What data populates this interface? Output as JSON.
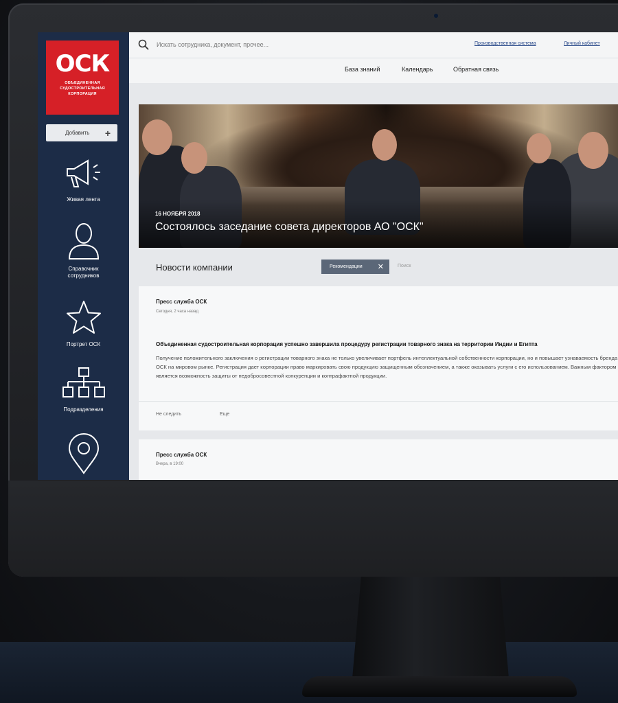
{
  "search": {
    "placeholder": "Искать сотрудника, документ, прочее..."
  },
  "header": {
    "links": [
      "Производственная система",
      "Личный кабинет"
    ],
    "nav": [
      "База знаний",
      "Календарь",
      "Обратная связь"
    ]
  },
  "sidebar": {
    "logo": {
      "mark": "ОСК",
      "line1": "ОБЪЕДИНЕННАЯ",
      "line2": "СУДОСТРОИТЕЛЬНАЯ",
      "line3": "КОРПОРАЦИЯ"
    },
    "add_label": "Добавить",
    "add_icon": "+",
    "items": [
      {
        "icon": "megaphone-icon",
        "label": "Живая лента"
      },
      {
        "icon": "person-icon",
        "label_line1": "Справочник",
        "label_line2": "сотрудников"
      },
      {
        "icon": "star-icon",
        "label": "Портрет ОСК"
      },
      {
        "icon": "org-chart-icon",
        "label": "Подразделения"
      },
      {
        "icon": "location-pin-icon"
      }
    ]
  },
  "hero": {
    "date": "16 НОЯБРЯ 2018",
    "title": "Состоялось заседание совета директоров АО \"ОСК\"",
    "arrow": "‹"
  },
  "news": {
    "section_title": "Новости компании",
    "filter_tag": "Рекомендации",
    "filter_close": "✕",
    "search_placeholder": "Поиск",
    "posts": [
      {
        "author": "Пресс служба ОСК",
        "time": "Сегодня, 2 часа назад",
        "headline": "Объединенная судостроительная корпорация успешно завершила процедуру регистрации товарного знака на территории Индии и Египта",
        "body": "Получение положительного заключения о регистрации товарного знака не только увеличивает портфель интеллектуальной собственности корпорации, но и повышает узнаваемость бренда ОСК на мировом рынке. Регистрация дает корпорации право маркировать свою продукцию защищенным обозначением, а также оказывать услуги с его использованием. Важным фактором является возможность защиты от недобросовестной конкуренции и контрафактной продукции.",
        "action_unfollow": "Не следить",
        "action_more": "Еще"
      },
      {
        "author": "Пресс служба ОСК",
        "time": "Вчера, в 19:00"
      }
    ]
  },
  "colors": {
    "brand_red": "#d62027",
    "sidebar_navy": "#1c2c47",
    "tag_grey": "#5b6778"
  }
}
